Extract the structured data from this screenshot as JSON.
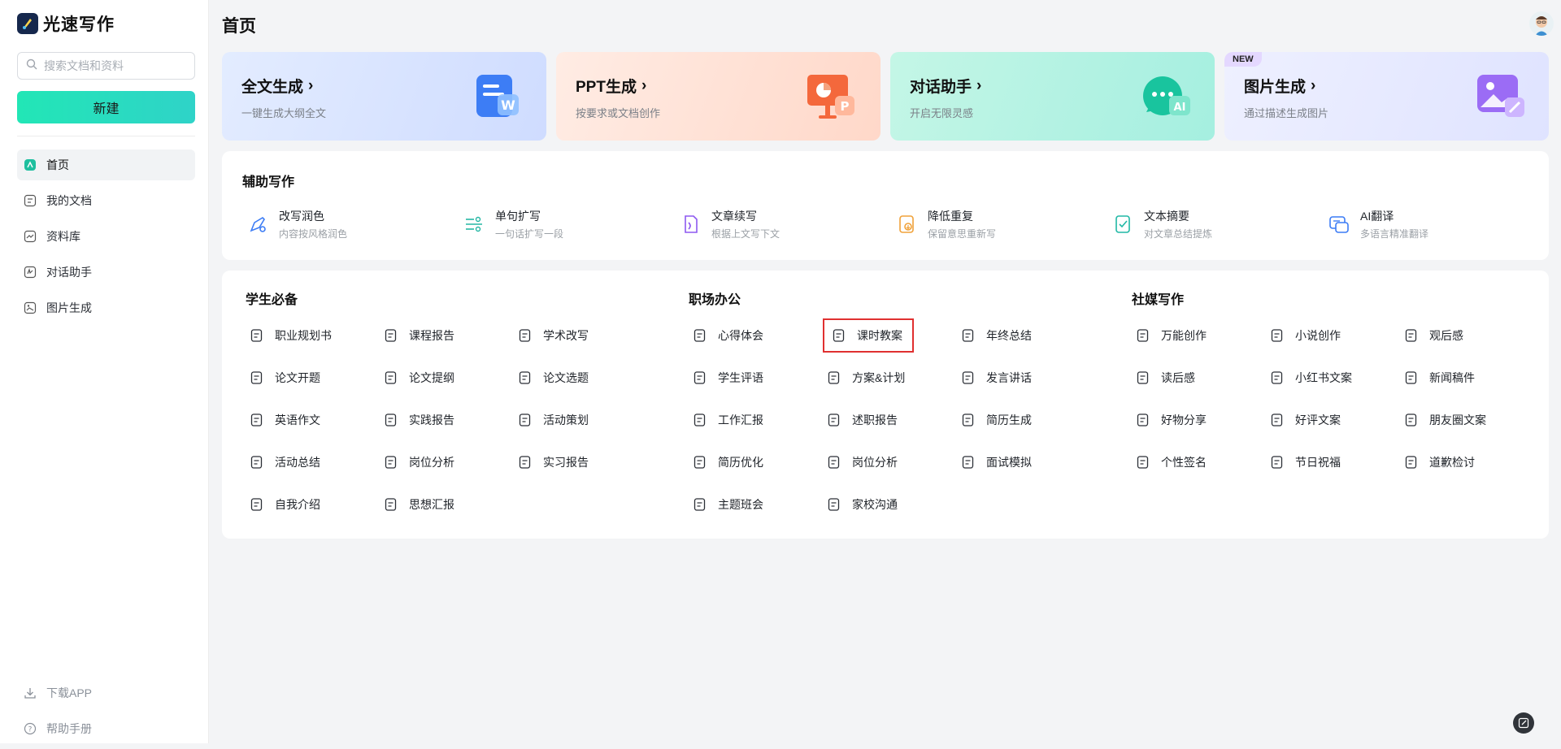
{
  "app": {
    "name": "光速写作"
  },
  "search": {
    "placeholder": "搜索文档和资料"
  },
  "new_button": "新建",
  "nav": [
    {
      "label": "首页",
      "icon": "home-icon",
      "active": true
    },
    {
      "label": "我的文档",
      "icon": "document-icon",
      "active": false
    },
    {
      "label": "资料库",
      "icon": "library-icon",
      "active": false
    },
    {
      "label": "对话助手",
      "icon": "chat-icon",
      "active": false
    },
    {
      "label": "图片生成",
      "icon": "image-icon",
      "active": false
    }
  ],
  "bottom": {
    "download": "下载APP",
    "help": "帮助手册"
  },
  "page_title": "首页",
  "cards": [
    {
      "title": "全文生成",
      "sub": "一键生成大纲全文",
      "bg": "#dfe9ff"
    },
    {
      "title": "PPT生成",
      "sub": "按要求或文档创作",
      "bg": "#ffe6dd"
    },
    {
      "title": "对话助手",
      "sub": "开启无限灵感",
      "bg": "#c9f7e9"
    },
    {
      "title": "图片生成",
      "sub": "通过描述生成图片",
      "bg": "#e6ebff",
      "badge": "NEW"
    }
  ],
  "assist": {
    "title": "辅助写作",
    "items": [
      {
        "name": "改写润色",
        "desc": "内容按风格润色",
        "icon": "rewrite-icon",
        "color": "#3c7cf5"
      },
      {
        "name": "单句扩写",
        "desc": "一句话扩写一段",
        "icon": "expand-icon",
        "color": "#25b7a4"
      },
      {
        "name": "文章续写",
        "desc": "根据上文写下文",
        "icon": "continue-icon",
        "color": "#8d59f0"
      },
      {
        "name": "降低重复",
        "desc": "保留意思重新写",
        "icon": "dedupe-icon",
        "color": "#f0a23a"
      },
      {
        "name": "文本摘要",
        "desc": "对文章总结提炼",
        "icon": "summary-icon",
        "color": "#20b8a5"
      },
      {
        "name": "AI翻译",
        "desc": "多语言精准翻译",
        "icon": "translate-icon",
        "color": "#3c7cf5"
      }
    ]
  },
  "sections": [
    {
      "title": "学生必备",
      "items": [
        "职业规划书",
        "课程报告",
        "学术改写",
        "论文开题",
        "论文提纲",
        "论文选题",
        "英语作文",
        "实践报告",
        "活动策划",
        "活动总结",
        "岗位分析",
        "实习报告",
        "自我介绍",
        "思想汇报"
      ]
    },
    {
      "title": "职场办公",
      "items": [
        "心得体会",
        "课时教案",
        "年终总结",
        "学生评语",
        "方案&计划",
        "发言讲话",
        "工作汇报",
        "述职报告",
        "简历生成",
        "简历优化",
        "岗位分析",
        "面试模拟",
        "主题班会",
        "家校沟通"
      ]
    },
    {
      "title": "社媒写作",
      "items": [
        "万能创作",
        "小说创作",
        "观后感",
        "读后感",
        "小红书文案",
        "新闻稿件",
        "好物分享",
        "好评文案",
        "朋友圈文案",
        "个性签名",
        "节日祝福",
        "道歉检讨"
      ]
    }
  ],
  "highlighted_item": "课时教案"
}
